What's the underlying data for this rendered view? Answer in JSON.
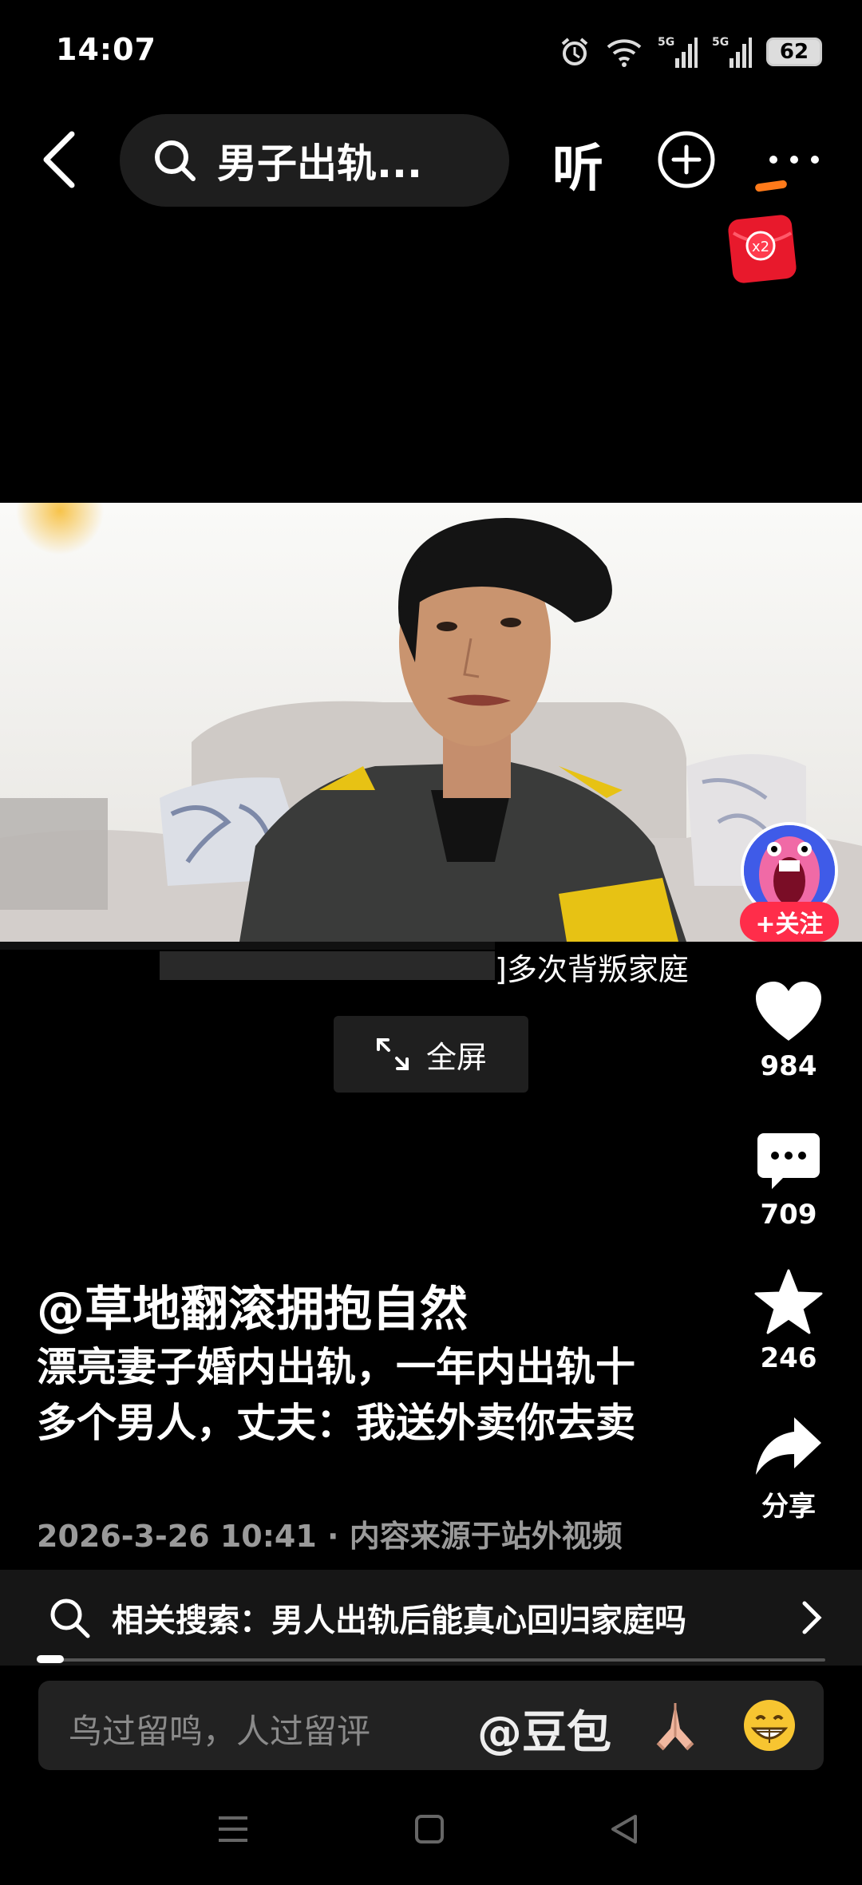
{
  "status_bar": {
    "time": "14:07",
    "battery": "62"
  },
  "top_bar": {
    "search_query": "男子出轨...",
    "listen_label": "听",
    "redpacket_label": "x2"
  },
  "video": {
    "subtitle": "]多次背叛家庭"
  },
  "fullscreen_label": "全屏",
  "right_rail": {
    "follow_label": "+关注",
    "likes": "984",
    "comments": "709",
    "favorites": "246",
    "share_label": "分享"
  },
  "post": {
    "author": "@草地翻滚拥抱自然",
    "caption": "漂亮妻子婚内出轨，一年内出轨十多个男人，丈夫：我送外卖你去卖",
    "meta": "2026-3-26 10:41 · 内容来源于站外视频"
  },
  "related_search": "相关搜索：男人出轨后能真心回归家庭吗",
  "comment_bar": {
    "placeholder": "鸟过留鸣，人过留评",
    "mention": "@豆包"
  },
  "colors": {
    "follow": "#ff2d4a",
    "accent_orange": "#ff7a1a",
    "background": "#000000"
  }
}
